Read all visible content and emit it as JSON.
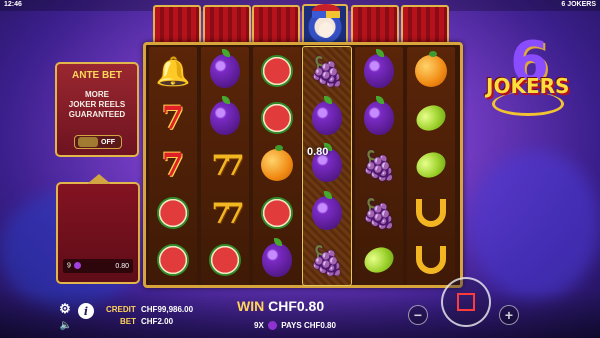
{
  "status_bar": {
    "time": "12:46",
    "game_name": "6 JOKERS"
  },
  "logo": {
    "number": "6",
    "word": "JOKERS"
  },
  "ante_bet": {
    "title": "ANTE BET",
    "description_lines": [
      "MORE",
      "JOKER REELS",
      "GUARANTEED"
    ],
    "toggle_state": "OFF"
  },
  "win_history": {
    "count": "9",
    "amount": "0.80"
  },
  "reels": [
    [
      "bell",
      "seven",
      "seven",
      "melon",
      "melon"
    ],
    [
      "plum",
      "plum",
      "seven-double",
      "seven-double",
      "melon"
    ],
    [
      "melon",
      "melon",
      "orange",
      "melon",
      "plum"
    ],
    [
      "grape",
      "plum",
      "plum",
      "plum",
      "grape"
    ],
    [
      "plum",
      "plum",
      "grape",
      "grape",
      "lemon"
    ],
    [
      "orange",
      "lemon",
      "lemon",
      "horseshoe",
      "horseshoe"
    ]
  ],
  "highlighted_reel": 3,
  "win_value_label": "0.80",
  "footer": {
    "credit_label": "CREDIT",
    "credit_value": "CHF99,986.00",
    "bet_label": "BET",
    "bet_value": "CHF2.00",
    "win_label": "WIN",
    "win_value": "CHF0.80",
    "pays_count": "9X",
    "pays_text": "PAYS CHF0.80"
  },
  "icons": {
    "settings": "gear-icon",
    "info": "info-icon",
    "sound": "speaker-icon",
    "minus": "minus-icon",
    "plus": "plus-icon",
    "spin": "spin-icon"
  },
  "colors": {
    "frame_gold": "#d7a53c",
    "accent_yellow": "#ffd35a",
    "curtain_red": "#b5121b",
    "background_purple": "#7a3fc9"
  }
}
